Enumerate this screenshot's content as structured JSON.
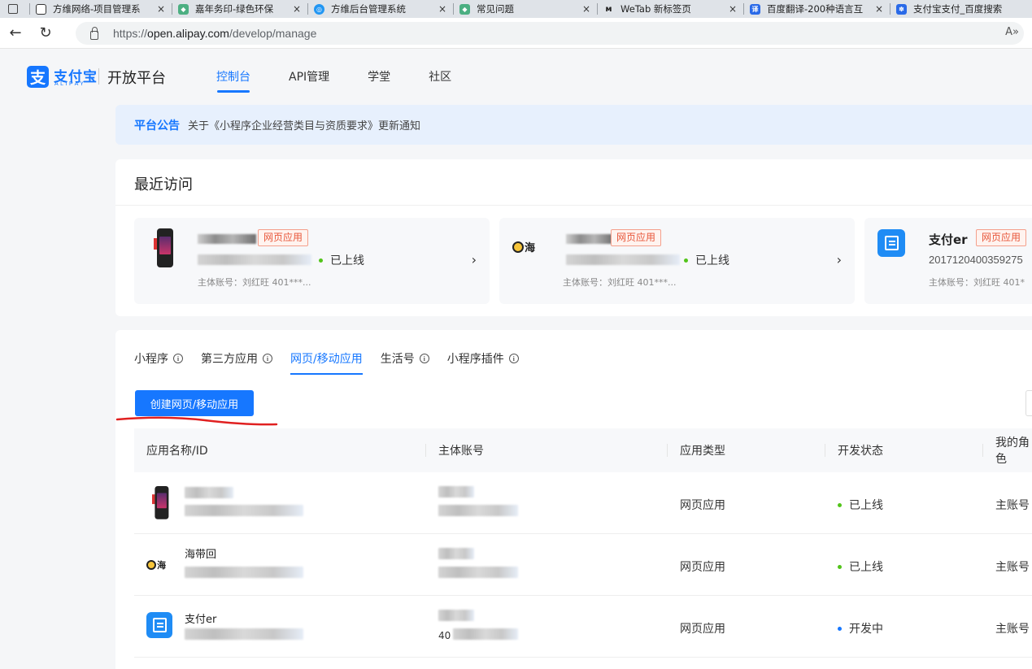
{
  "browser": {
    "tabs": [
      {
        "title": "方维网络-项目管理系",
        "icon_color": "#ffffff",
        "close": "×"
      },
      {
        "title": "嘉年务印-绿色环保",
        "icon_color": "#4caf82",
        "close": "×"
      },
      {
        "title": "方维后台管理系统",
        "icon_color": "#2196f3",
        "close": "×"
      },
      {
        "title": "常见问题",
        "icon_color": "#4caf82",
        "close": "×"
      },
      {
        "title": "WeTab 新标签页",
        "icon_color": "#222222",
        "close": "×"
      },
      {
        "title": "百度翻译-200种语言互",
        "icon_color": "#2a6ae8",
        "close": "×"
      },
      {
        "title": "支付宝支付_百度搜索",
        "icon_color": "#2a6ae8",
        "close": ""
      }
    ],
    "url_prefix": "https://",
    "url_host": "open.alipay.com",
    "url_path": "/develop/manage",
    "reader_icon": "A»"
  },
  "header": {
    "logo_mark": "支",
    "logo_text": "支付宝",
    "logo_sub": "ALIPAY",
    "platform": "开放平台",
    "nav": [
      "控制台",
      "API管理",
      "学堂",
      "社区"
    ],
    "active_nav": "控制台"
  },
  "notice": {
    "tag": "平台公告",
    "text": "关于《小程序企业经营类目与资质要求》更新通知"
  },
  "recent": {
    "title": "最近访问",
    "cards": [
      {
        "tag": "网页应用",
        "status": "已上线",
        "status_color": "green",
        "owner": "主体账号：刘红旺 401***..."
      },
      {
        "logo_text": "海",
        "tag": "网页应用",
        "status": "已上线",
        "status_color": "green",
        "owner": "主体账号：刘红旺 401***..."
      },
      {
        "name": "支付er",
        "tag": "网页应用",
        "app_id": "2017120400359275",
        "owner": "主体账号：刘红旺 401*"
      }
    ]
  },
  "apps": {
    "tabs": [
      {
        "label": "小程序",
        "info": "i"
      },
      {
        "label": "第三方应用",
        "info": "i"
      },
      {
        "label": "网页/移动应用",
        "info": ""
      },
      {
        "label": "生活号",
        "info": "i"
      },
      {
        "label": "小程序插件",
        "info": "i"
      }
    ],
    "active_tab": "网页/移动应用",
    "create_button": "创建网页/移动应用",
    "columns": [
      "应用名称/ID",
      "主体账号",
      "应用类型",
      "开发状态",
      "我的角色"
    ],
    "rows": [
      {
        "name": "",
        "owner_text": "",
        "type": "网页应用",
        "status": "已上线",
        "status_color": "green",
        "role": "主账号"
      },
      {
        "name": "海带回",
        "owner_text": "",
        "type": "网页应用",
        "status": "已上线",
        "status_color": "green",
        "role": "主账号"
      },
      {
        "name": "支付er",
        "owner_text": "40",
        "type": "网页应用",
        "status": "开发中",
        "status_color": "blue",
        "role": "主账号"
      }
    ]
  },
  "colors": {
    "accent": "#1677ff",
    "online": "#52c41a",
    "tag_red": "#e8573a",
    "annotation": "#e02020"
  }
}
